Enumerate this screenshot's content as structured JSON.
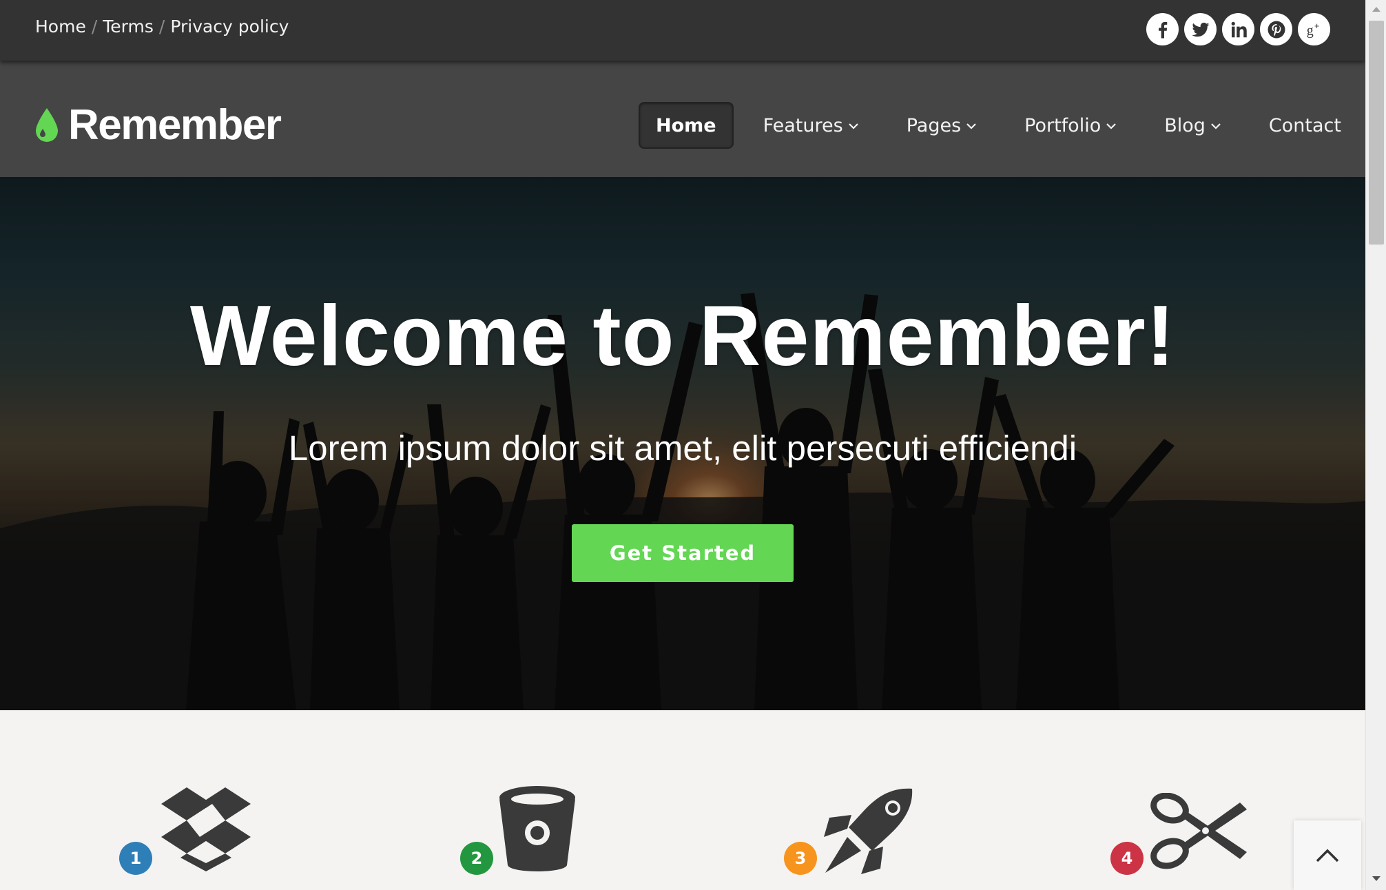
{
  "breadcrumb": {
    "items": [
      "Home",
      "Terms",
      "Privacy policy"
    ],
    "separator": "/"
  },
  "social": [
    {
      "name": "facebook-icon"
    },
    {
      "name": "twitter-icon"
    },
    {
      "name": "linkedin-icon"
    },
    {
      "name": "pinterest-icon"
    },
    {
      "name": "google-plus-icon"
    }
  ],
  "logo": {
    "text": "Remember",
    "icon": "water-drop-icon",
    "icon_color": "#63d654"
  },
  "nav": {
    "items": [
      {
        "label": "Home",
        "active": true,
        "dropdown": false
      },
      {
        "label": "Features",
        "active": false,
        "dropdown": true
      },
      {
        "label": "Pages",
        "active": false,
        "dropdown": true
      },
      {
        "label": "Portfolio",
        "active": false,
        "dropdown": true
      },
      {
        "label": "Blog",
        "active": false,
        "dropdown": true
      },
      {
        "label": "Contact",
        "active": false,
        "dropdown": false
      }
    ]
  },
  "hero": {
    "title": "Welcome to Remember!",
    "subtitle": "Lorem ipsum dolor sit amet, elit persecuti efficiendi",
    "cta_label": "Get Started",
    "cta_color": "#63d654"
  },
  "features": [
    {
      "number": "1",
      "icon": "dropbox-icon",
      "badge_color": "#2e7fb8"
    },
    {
      "number": "2",
      "icon": "bitbucket-icon",
      "badge_color": "#23973f"
    },
    {
      "number": "3",
      "icon": "rocket-icon",
      "badge_color": "#f7941d"
    },
    {
      "number": "4",
      "icon": "scissors-icon",
      "badge_color": "#cc3344"
    }
  ],
  "scroll_to_top": {
    "icon": "chevron-up-icon"
  }
}
